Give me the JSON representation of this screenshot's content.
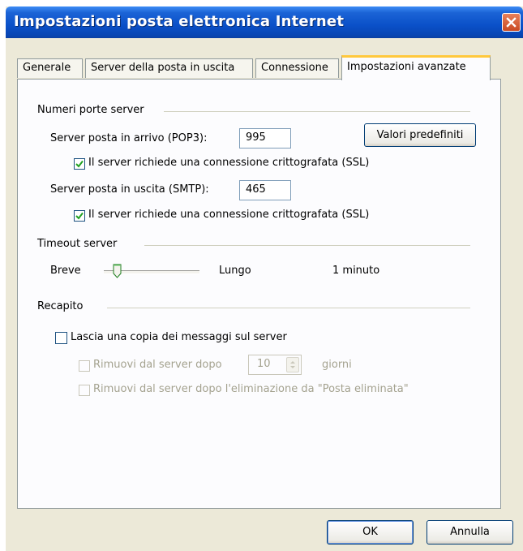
{
  "window": {
    "title": "Impostazioni posta elettronica Internet"
  },
  "tabs": [
    {
      "label": "Generale"
    },
    {
      "label": "Server della posta in uscita"
    },
    {
      "label": "Connessione"
    },
    {
      "label": "Impostazioni avanzate",
      "active": true
    }
  ],
  "ports": {
    "section_label": "Numeri porte server",
    "incoming_label": "Server posta in arrivo (POP3):",
    "incoming_value": "995",
    "incoming_ssl_label": "Il server richiede una connessione crittografata (SSL)",
    "incoming_ssl_checked": true,
    "outgoing_label": "Server posta in uscita (SMTP):",
    "outgoing_value": "465",
    "outgoing_ssl_label": "Il server richiede una connessione crittografata (SSL)",
    "outgoing_ssl_checked": true,
    "defaults_button": "Valori predefiniti"
  },
  "timeout": {
    "section_label": "Timeout server",
    "short_label": "Breve",
    "long_label": "Lungo",
    "value_text": "1 minuto",
    "level": 0.1
  },
  "delivery": {
    "section_label": "Recapito",
    "leave_copy_label": "Lascia una copia dei messaggi sul server",
    "leave_copy_checked": false,
    "remove_after_label": "Rimuovi dal server dopo",
    "remove_after_value": "10",
    "days_label": "giorni",
    "remove_when_deleted_label": "Rimuovi dal server dopo l'eliminazione da \"Posta eliminata\""
  },
  "footer": {
    "ok_label": "OK",
    "cancel_label": "Annulla"
  },
  "colors": {
    "titlebar": "#0a50c8",
    "dialog_bg": "#ece9d8",
    "tab_highlight": "#ffc83c",
    "check_mark": "#21a121"
  }
}
